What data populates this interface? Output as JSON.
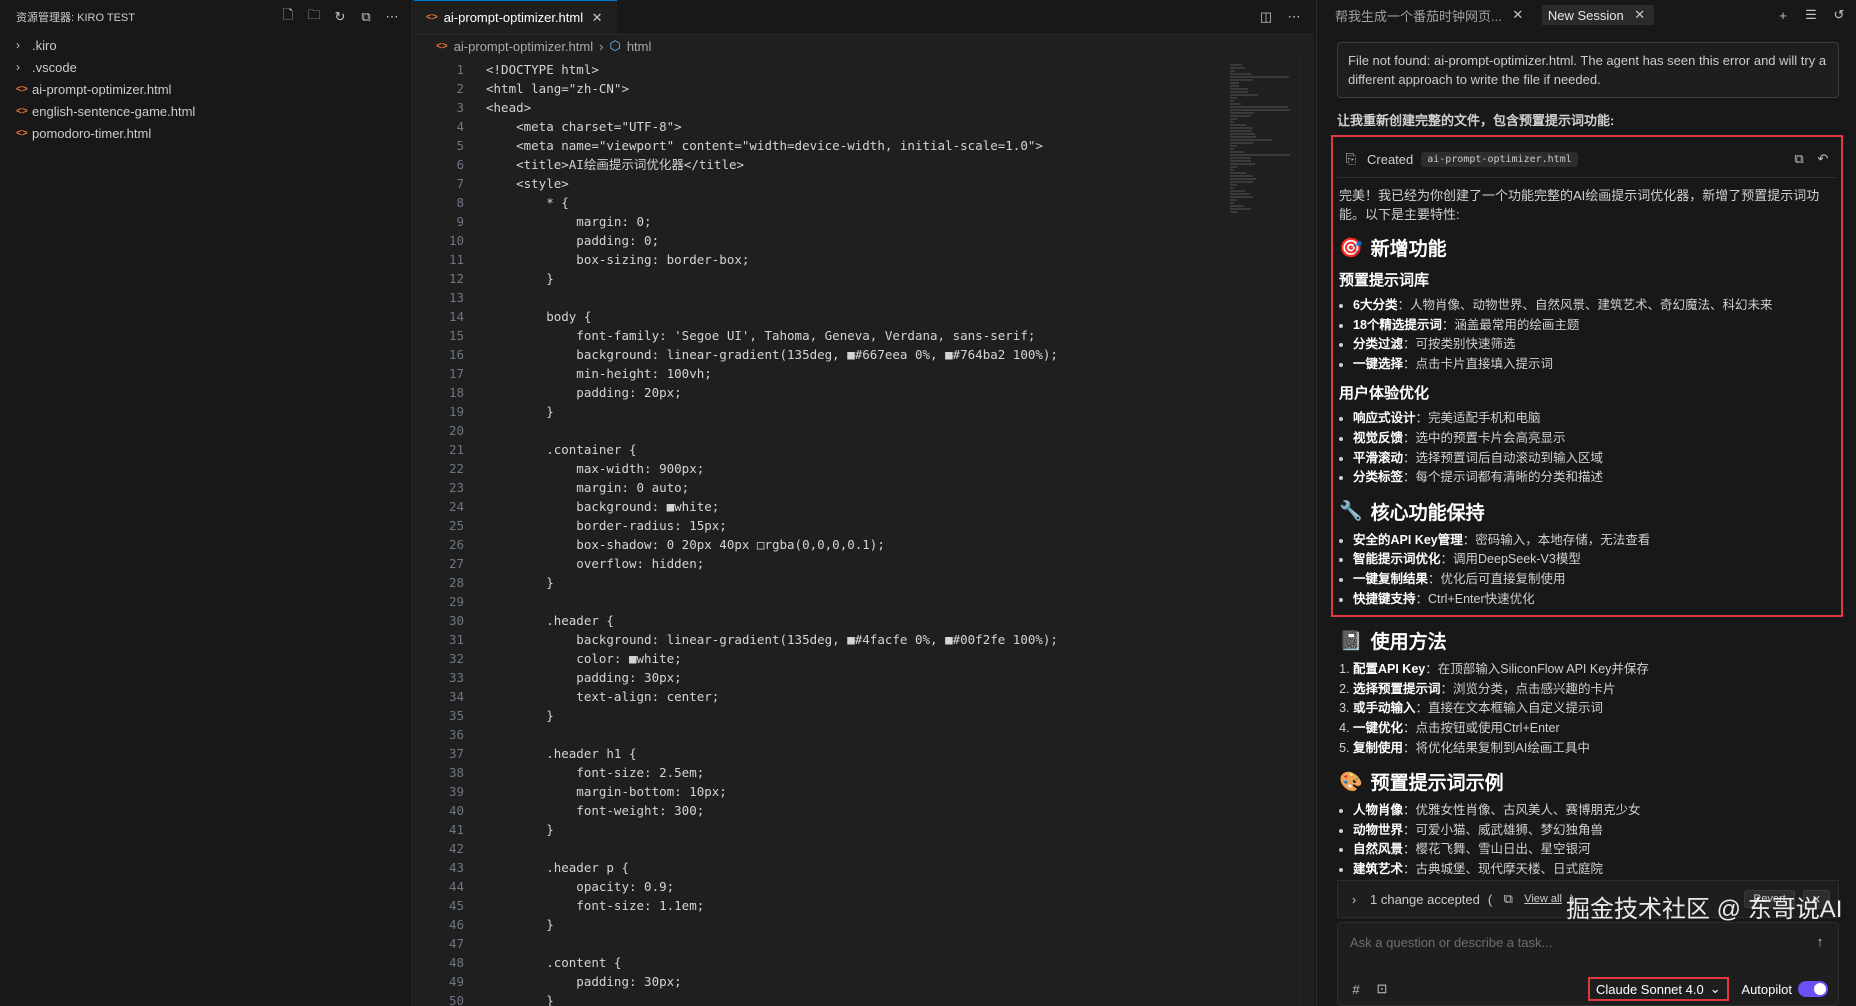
{
  "explorer": {
    "title": "资源管理器: KIRO TEST",
    "items": [
      {
        "label": ".kiro",
        "kind": "folder"
      },
      {
        "label": ".vscode",
        "kind": "folder"
      },
      {
        "label": "ai-prompt-optimizer.html",
        "kind": "html"
      },
      {
        "label": "english-sentence-game.html",
        "kind": "html"
      },
      {
        "label": "pomodoro-timer.html",
        "kind": "html"
      }
    ]
  },
  "editor": {
    "tab_label": "ai-prompt-optimizer.html",
    "breadcrumb": [
      "ai-prompt-optimizer.html",
      "html"
    ],
    "lines": [
      "<!DOCTYPE html>",
      "<html lang=\"zh-CN\">",
      "<head>",
      "    <meta charset=\"UTF-8\">",
      "    <meta name=\"viewport\" content=\"width=device-width, initial-scale=1.0\">",
      "    <title>AI绘画提示词优化器</title>",
      "    <style>",
      "        * {",
      "            margin: 0;",
      "            padding: 0;",
      "            box-sizing: border-box;",
      "        }",
      "",
      "        body {",
      "            font-family: 'Segoe UI', Tahoma, Geneva, Verdana, sans-serif;",
      "            background: linear-gradient(135deg, ■#667eea 0%, ■#764ba2 100%);",
      "            min-height: 100vh;",
      "            padding: 20px;",
      "        }",
      "",
      "        .container {",
      "            max-width: 900px;",
      "            margin: 0 auto;",
      "            background: ■white;",
      "            border-radius: 15px;",
      "            box-shadow: 0 20px 40px □rgba(0,0,0,0.1);",
      "            overflow: hidden;",
      "        }",
      "",
      "        .header {",
      "            background: linear-gradient(135deg, ■#4facfe 0%, ■#00f2fe 100%);",
      "            color: ■white;",
      "            padding: 30px;",
      "            text-align: center;",
      "        }",
      "",
      "        .header h1 {",
      "            font-size: 2.5em;",
      "            margin-bottom: 10px;",
      "            font-weight: 300;",
      "        }",
      "",
      "        .header p {",
      "            opacity: 0.9;",
      "            font-size: 1.1em;",
      "        }",
      "",
      "        .content {",
      "            padding: 30px;",
      "        }"
    ]
  },
  "chat": {
    "tabs": [
      "帮我生成一个番茄时钟网页...",
      "New Session"
    ],
    "notice": "File not found: ai-prompt-optimizer.html. The agent has seen this error and will try a different approach to write the file if needed.",
    "lead": "让我重新创建完整的文件，包含预置提示词功能:",
    "created_label": "Created",
    "created_file": "ai-prompt-optimizer.html",
    "summary": "完美！我已经为你创建了一个功能完整的AI绘画提示词优化器，新增了预置提示词功能。以下是主要特性:",
    "sections": {
      "new_features": {
        "title": "新增功能",
        "sub1": "预置提示词库",
        "sub1_items": [
          {
            "k": "6大分类",
            "v": "：人物肖像、动物世界、自然风景、建筑艺术、奇幻魔法、科幻未来"
          },
          {
            "k": "18个精选提示词",
            "v": "：涵盖最常用的绘画主题"
          },
          {
            "k": "分类过滤",
            "v": "：可按类别快速筛选"
          },
          {
            "k": "一键选择",
            "v": "：点击卡片直接填入提示词"
          }
        ],
        "sub2": "用户体验优化",
        "sub2_items": [
          {
            "k": "响应式设计",
            "v": "：完美适配手机和电脑"
          },
          {
            "k": "视觉反馈",
            "v": "：选中的预置卡片会高亮显示"
          },
          {
            "k": "平滑滚动",
            "v": "：选择预置词后自动滚动到输入区域"
          },
          {
            "k": "分类标签",
            "v": "：每个提示词都有清晰的分类和描述"
          }
        ]
      },
      "core": {
        "title": "核心功能保持",
        "items": [
          {
            "k": "安全的API Key管理",
            "v": "：密码输入，本地存储，无法查看"
          },
          {
            "k": "智能提示词优化",
            "v": "：调用DeepSeek-V3模型"
          },
          {
            "k": "一键复制结果",
            "v": "：优化后可直接复制使用"
          },
          {
            "k": "快捷键支持",
            "v": "：Ctrl+Enter快速优化"
          }
        ]
      },
      "usage": {
        "title": "使用方法",
        "items": [
          {
            "k": "配置API Key",
            "v": "：在顶部输入SiliconFlow API Key并保存"
          },
          {
            "k": "选择预置提示词",
            "v": "：浏览分类，点击感兴趣的卡片"
          },
          {
            "k": "或手动输入",
            "v": "：直接在文本框输入自定义提示词"
          },
          {
            "k": "一键优化",
            "v": "：点击按钮或使用Ctrl+Enter"
          },
          {
            "k": "复制使用",
            "v": "：将优化结果复制到AI绘画工具中"
          }
        ]
      },
      "examples": {
        "title": "预置提示词示例",
        "items": [
          {
            "k": "人物肖像",
            "v": "：优雅女性肖像、古风美人、赛博朋克少女"
          },
          {
            "k": "动物世界",
            "v": "：可爱小猫、威武雄狮、梦幻独角兽"
          },
          {
            "k": "自然风景",
            "v": "：樱花飞舞、雪山日出、星空银河"
          },
          {
            "k": "建筑艺术",
            "v": "：古典城堡、现代摩天楼、日式庭院"
          }
        ]
      }
    },
    "accepted": "1 change accepted",
    "view_all": "View all",
    "revert": "Revert",
    "input_placeholder": "Ask a question or describe a task...",
    "model": "Claude Sonnet 4.0",
    "autopilot": "Autopilot",
    "watermark": "掘金技术社区 @ 东哥说AI"
  }
}
